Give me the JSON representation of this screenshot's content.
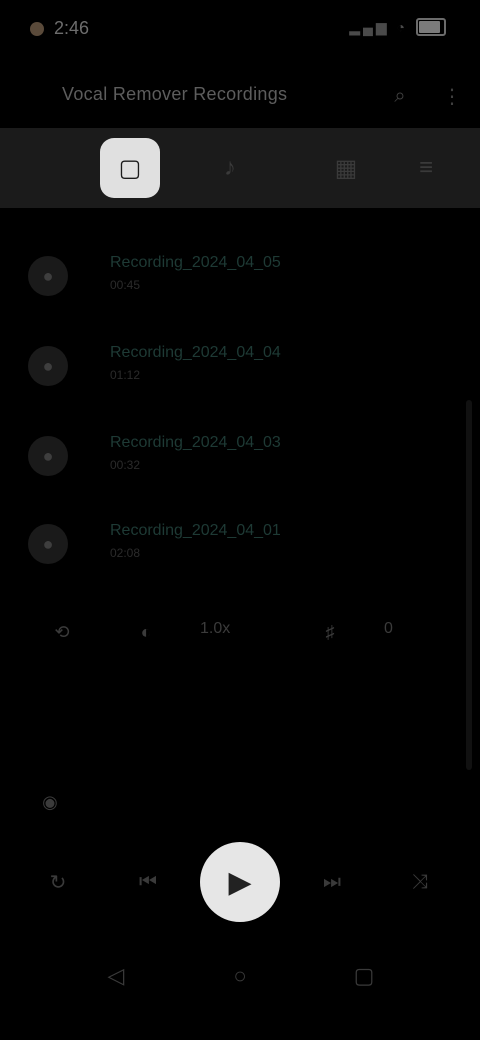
{
  "status_bar": {
    "time": "2:46",
    "icons": "▂▄▆ ◔"
  },
  "top_bar": {
    "title": "Vocal Remover Recordings",
    "search_icon": "⌕",
    "more_icon": "⋮"
  },
  "toolbar": {
    "items": [
      {
        "icon": "square-icon",
        "glyph": "▢"
      },
      {
        "icon": "music-note-icon",
        "glyph": "♪"
      },
      {
        "icon": "grid-icon",
        "glyph": "▦"
      },
      {
        "icon": "sliders-icon",
        "glyph": "≡"
      }
    ]
  },
  "recordings": [
    {
      "title": "Recording_2024_04_05",
      "sub": "00:45"
    },
    {
      "title": "Recording_2024_04_04",
      "sub": "01:12"
    },
    {
      "title": "Recording_2024_04_03",
      "sub": "00:32"
    },
    {
      "title": "Recording_2024_04_01",
      "sub": "02:08"
    }
  ],
  "controls": {
    "speed": "1.0x",
    "pitch": "0"
  },
  "player": {
    "loop_icon": "↻",
    "prev_icon": "⏮",
    "play_icon": "▶",
    "next_icon": "⏭",
    "shuffle_icon": "⤨"
  },
  "nav": {
    "back_icon": "◁",
    "home_icon": "○",
    "recent_icon": "▢"
  }
}
